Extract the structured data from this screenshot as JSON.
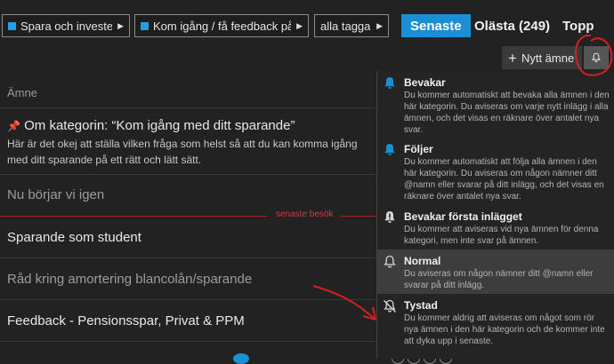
{
  "breadcrumbs": [
    {
      "label": "Spara och investera",
      "color": "#1fa0e6"
    },
    {
      "label": "Kom igång / få feedback på din",
      "color": "#1fa0e6"
    },
    {
      "label": "alla taggar"
    }
  ],
  "nav": {
    "latest": "Senaste",
    "unread": "Olästa (249)",
    "top": "Topp"
  },
  "toolbar": {
    "new_topic": "Nytt ämne",
    "notifications_icon": "bell-icon"
  },
  "list": {
    "header": "Ämne",
    "pinned": {
      "title": "Om kategorin: “Kom igång med ditt sparande”",
      "excerpt": "Här är det okej att ställa vilken fråga som helst så att du kan komma igång med ditt sparande på ett rätt och lätt sätt."
    },
    "topics": [
      "Nu börjar vi igen",
      "Sparande som student",
      "Råd kring amortering blancolån/sparande",
      "Feedback - Pensionsspar, Privat & PPM"
    ],
    "last_visit_label": "senaste besök"
  },
  "notification_menu": {
    "options": [
      {
        "title": "Bevakar",
        "icon": "bell-filled-icon",
        "description": "Du kommer automatiskt att bevaka alla ämnen i den här kategorin. Du aviseras om varje nytt inlägg i alla ämnen, och det visas en räknare över antalet nya svar."
      },
      {
        "title": "Följer",
        "icon": "bell-filled-icon",
        "description": "Du kommer automatiskt att följa alla ämnen i den här kategorin. Du aviseras om någon nämner ditt @namn eller svarar på ditt inlägg, och det visas en räknare över antalet nya svar."
      },
      {
        "title": "Bevakar första inlägget",
        "icon": "bell-exclamation-icon",
        "description": "Du kommer att aviseras vid nya ämnen för denna kategori, men inte svar på ämnen."
      },
      {
        "title": "Normal",
        "icon": "bell-outline-icon",
        "selected": true,
        "description": "Du aviseras om någon nämner ditt @namn eller svarar på ditt inlägg."
      },
      {
        "title": "Tystad",
        "icon": "bell-slash-icon",
        "description": "Du kommer aldrig att aviseras om något som rör nya ämnen i den här kategorin och de kommer inte att dyka upp i senaste."
      }
    ]
  },
  "colors": {
    "accent": "#1a8fd6",
    "annotation": "#d42020",
    "last_visit": "#d03a3a"
  }
}
